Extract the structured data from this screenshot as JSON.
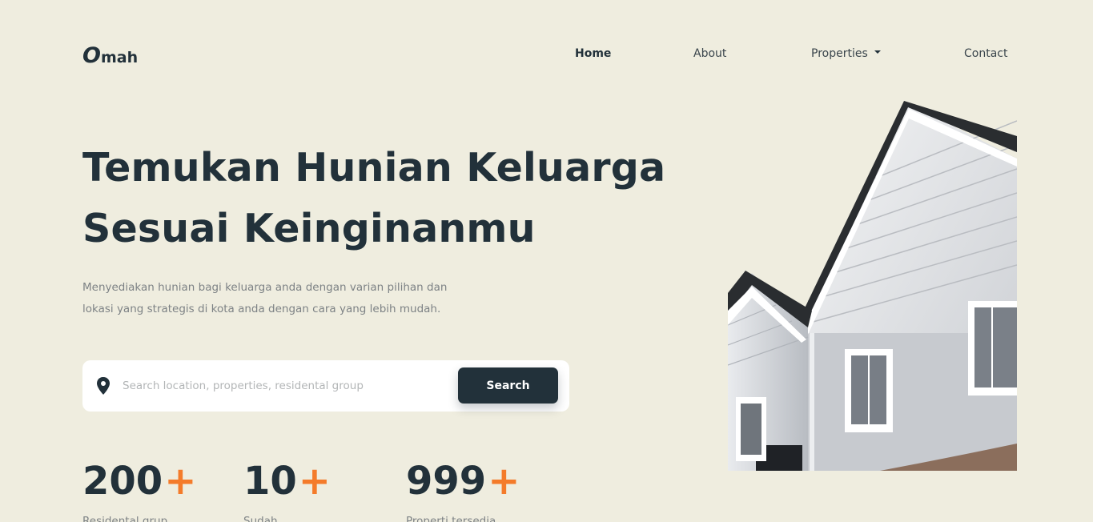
{
  "logo": {
    "mark": "O",
    "text": "mah"
  },
  "nav": {
    "items": [
      {
        "label": "Home",
        "active": true
      },
      {
        "label": "About",
        "active": false
      },
      {
        "label": "Properties",
        "active": false,
        "has_dropdown": true
      },
      {
        "label": "Contact",
        "active": false
      }
    ]
  },
  "hero": {
    "title_line1": "Temukan Hunian Keluarga",
    "title_line2": "Sesuai Keinginanmu",
    "desc_line1": "Menyediakan hunian bagi keluarga anda dengan varian pilihan dan",
    "desc_line2": "lokasi yang strategis di kota anda dengan cara yang lebih mudah."
  },
  "search": {
    "placeholder": "Search location, properties, residental group",
    "value": "",
    "button_label": "Search",
    "icon": "map-pin-icon"
  },
  "stats": [
    {
      "value": "200",
      "suffix": "+",
      "label": "Residental grup"
    },
    {
      "value": "10",
      "suffix": "+",
      "label": "Sudah"
    },
    {
      "value": "999",
      "suffix": "+",
      "label": "Properti tersedia"
    }
  ],
  "colors": {
    "background": "#efeddf",
    "primary": "#22313a",
    "accent": "#f47b2a",
    "muted_text": "#7d8285"
  }
}
